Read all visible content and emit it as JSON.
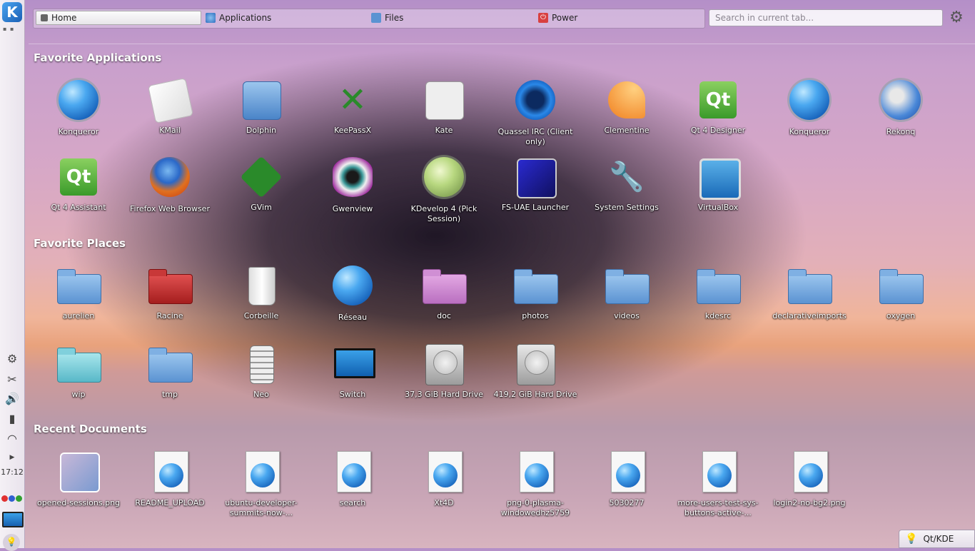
{
  "search": {
    "placeholder": "Search in current tab..."
  },
  "tabs": [
    {
      "label": "Home",
      "icon": "home-icon"
    },
    {
      "label": "Applications",
      "icon": "applications-icon"
    },
    {
      "label": "Files",
      "icon": "folder-icon"
    },
    {
      "label": "Power",
      "icon": "power-icon"
    }
  ],
  "sections": {
    "favorite_applications": "Favorite Applications",
    "favorite_places": "Favorite Places",
    "recent_documents": "Recent Documents"
  },
  "applications": [
    "Konqueror",
    "KMail",
    "Dolphin",
    "KeePassX",
    "Kate",
    "Quassel IRC (Client only)",
    "Clementine",
    "Qt 4 Designer",
    "Konqueror",
    "Rekonq",
    "Qt 4 Assistant",
    "Firefox Web Browser",
    "GVim",
    "Gwenview",
    "KDevelop 4 (Pick Session)",
    "FS-UAE Launcher",
    "System Settings",
    "VirtualBox"
  ],
  "places": [
    "aurelien",
    "Racine",
    "Corbeille",
    "Réseau",
    "doc",
    "photos",
    "videos",
    "kdesrc",
    "declarativeimports",
    "oxygen",
    "wip",
    "tmp",
    "Neo",
    "Switch",
    "37,3 GiB Hard Drive",
    "419,2 GiB Hard Drive"
  ],
  "documents": [
    "opened-sessions.png",
    "README_UPLOAD",
    "ubuntu-developer-summits-now-...",
    "search",
    "Xt4D",
    "png-0-plasma-windowedhz5759",
    "5030277",
    "more-users-test-sys-buttons-active-...",
    "login2-no-bg2.png"
  ],
  "tray": {
    "time": "17:12"
  },
  "taskbar": {
    "window_label": "Qt/KDE"
  },
  "colors": {
    "accent": "#4aa8f0",
    "panel": "#f4f0f5"
  }
}
